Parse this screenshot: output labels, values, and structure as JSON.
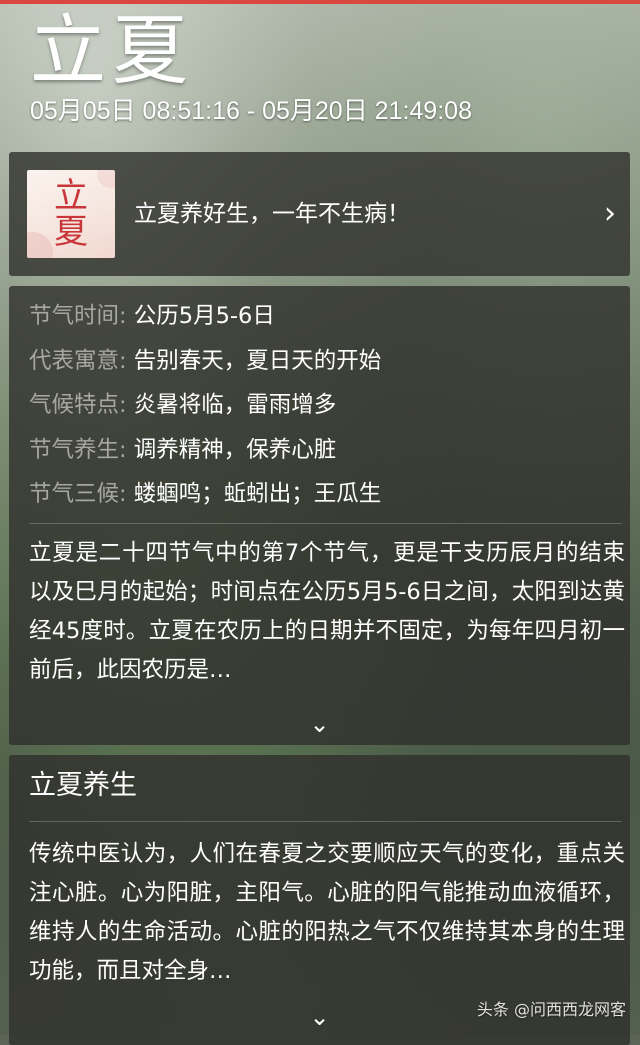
{
  "header": {
    "title": "立夏",
    "date_range": "05月05日 08:51:16 - 05月20日 21:49:08"
  },
  "article": {
    "thumbnail_chars": [
      "立",
      "夏"
    ],
    "title": "立夏养好生，一年不生病！",
    "chevron": "›"
  },
  "info": {
    "rows": [
      {
        "label": "节气时间:",
        "value": "公历5月5-6日"
      },
      {
        "label": "代表寓意:",
        "value": "告别春天，夏日天的开始"
      },
      {
        "label": "气候特点:",
        "value": "炎暑将临，雷雨增多"
      },
      {
        "label": "节气养生:",
        "value": "调养精神，保养心脏"
      },
      {
        "label": "节气三候:",
        "value": "蝼蝈鸣；蚯蚓出；王瓜生"
      }
    ],
    "description": "立夏是二十四节气中的第7个节气，更是干支历辰月的结束以及巳月的起始；时间点在公历5月5-6日之间，太阳到达黄经45度时。立夏在农历上的日期并不固定，为每年四月初一前后，此因农历是…",
    "expand_icon": "⌄"
  },
  "health": {
    "title": "立夏养生",
    "text": "传统中医认为，人们在春夏之交要顺应天气的变化，重点关注心脏。心为阳脏，主阳气。心脏的阳气能推动血液循环，维持人的生命活动。心脏的阳热之气不仅维持其本身的生理功能，而且对全身…",
    "expand_icon": "⌄"
  },
  "watermark": "头条 @问西西龙网客",
  "colors": {
    "accent_bar": "#d8483f",
    "card_bg": "rgba(48,48,44,0.80)",
    "label_gray": "#a7a7a2",
    "thumb_red": "#c9363a"
  },
  "icons": {
    "article_chevron": "chevron-right-icon",
    "expand": "chevron-down-icon"
  }
}
